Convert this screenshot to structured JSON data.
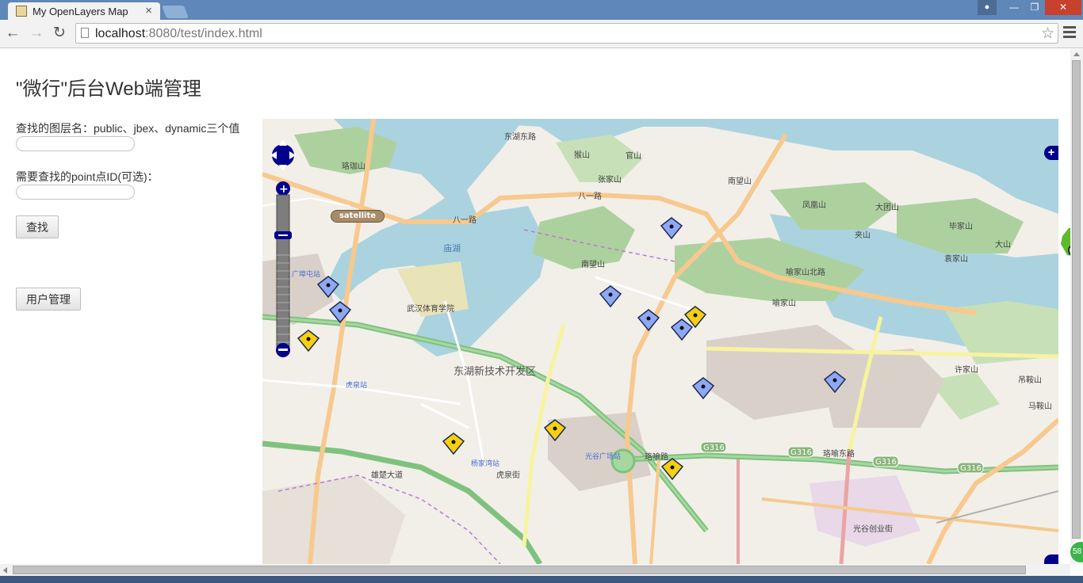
{
  "browser": {
    "tab_title": "My OpenLayers Map",
    "tab_close": "×",
    "url_host": "localhost",
    "url_path": ":8080/test/index.html",
    "window_min": "—",
    "window_max": "❐",
    "window_close": "✕"
  },
  "page": {
    "title": "\"微行\"后台Web端管理",
    "layer_label": "查找的图层名：public、jbex、dynamic三个值",
    "layer_value": "",
    "point_label": "需要查找的point点ID(可选)：",
    "point_value": "",
    "search_button": "查找",
    "user_button": "用户管理"
  },
  "map": {
    "satellite_label": "satellite",
    "layer_switcher": "+",
    "marker_colors": {
      "blue": "#8ea8f4",
      "yellow": "#f6d010",
      "outline": "#1f2a55"
    },
    "labels": {
      "lake": "庙湖",
      "zone": "东湖新技术开发区",
      "stadium": "武汉体育学院",
      "guanggu": "光谷广场站",
      "luojiashan": "珞珈山",
      "shuangshan": "猴山",
      "guanshan": "官山",
      "zhangjiashan": "张家山",
      "nanwangshan": "南望山",
      "nanwangshan2": "南望山",
      "fengshan": "凤凰山",
      "datuanshan": "大团山",
      "jiashan": "夹山",
      "bijiashan": "毕家山",
      "dashan": "大山",
      "yuanjiashan": "袁家山",
      "yujiashan": "喻家山",
      "xujiashan": "许家山",
      "diaoanshan": "吊鞍山",
      "maanshan": "马鞍山",
      "bayi_road": "八一路",
      "bayi_road2": "八一路",
      "donghu_east": "东湖东路",
      "yujiashan_north": "喻家山北路",
      "luoyu_road": "珞喻路",
      "luoyu_east": "珞喻东路",
      "xiongchu": "雄楚大道",
      "guanggu_chuangye": "光谷创业街",
      "huquan": "虎泉街",
      "g316": "G316",
      "huquan_station": "虎泉站",
      "yangjiawan": "杨家湾站",
      "guangbutun": "广埠屯站"
    }
  }
}
